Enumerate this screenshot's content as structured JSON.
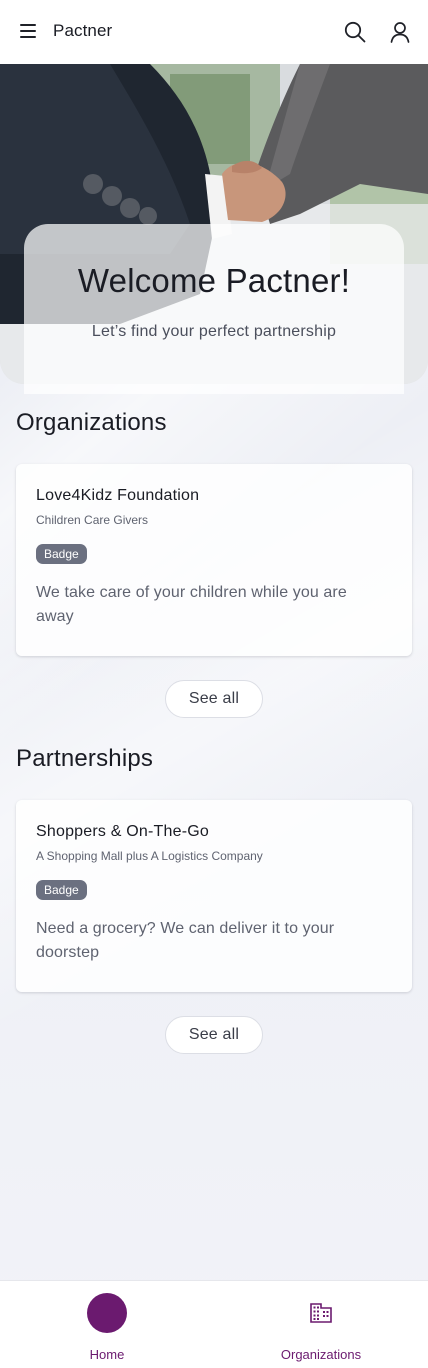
{
  "app": {
    "title": "Pactner"
  },
  "icons": {
    "menu": "menu-icon",
    "search": "search-icon",
    "account": "account-icon",
    "home": "home-icon",
    "organizations": "building-icon"
  },
  "hero": {
    "title": "Welcome Pactner!",
    "subtitle": "Let’s find your perfect partnership"
  },
  "sections": {
    "organizations": {
      "heading": "Organizations",
      "card": {
        "title": "Love4Kidz Foundation",
        "subtitle": "Children Care Givers",
        "badge": "Badge",
        "text": "We take care of your children while you are away"
      },
      "see_all": "See all"
    },
    "partnerships": {
      "heading": "Partnerships",
      "card": {
        "title": "Shoppers & On-The-Go",
        "subtitle": "A Shopping Mall plus A Logistics Company",
        "badge": "Badge",
        "text": "Need a grocery? We can deliver it to your doorstep"
      },
      "see_all": "See all"
    }
  },
  "bottom_nav": {
    "items": [
      {
        "label": "Home",
        "active": true
      },
      {
        "label": "Organizations",
        "active": false
      }
    ]
  },
  "colors": {
    "accent": "#6b1a6f",
    "badge": "#6b7080",
    "background": "#eef0f5"
  }
}
